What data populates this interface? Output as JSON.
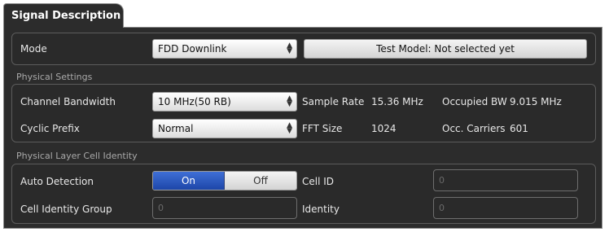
{
  "tab": {
    "label": "Signal Description"
  },
  "mode": {
    "label": "Mode",
    "select_value": "FDD Downlink",
    "test_model_button": "Test Model: Not selected yet"
  },
  "physical_settings": {
    "section_label": "Physical Settings",
    "channel_bandwidth": {
      "label": "Channel Bandwidth",
      "value": "10 MHz(50 RB)"
    },
    "cyclic_prefix": {
      "label": "Cyclic Prefix",
      "value": "Normal"
    },
    "sample_rate": {
      "label": "Sample Rate",
      "value": "15.36 MHz"
    },
    "fft_size": {
      "label": "FFT Size",
      "value": "1024"
    },
    "occupied_bw": {
      "label": "Occupied BW",
      "value": "9.015 MHz"
    },
    "occ_carriers": {
      "label": "Occ. Carriers",
      "value": "601"
    }
  },
  "cell_identity": {
    "section_label": "Physical Layer Cell Identity",
    "auto_detection": {
      "label": "Auto Detection",
      "on": "On",
      "off": "Off"
    },
    "cell_identity_group": {
      "label": "Cell Identity Group",
      "value": "0"
    },
    "cell_id": {
      "label": "Cell ID",
      "value": "0"
    },
    "identity": {
      "label": "Identity",
      "value": "0"
    }
  },
  "colors": {
    "panel_bg": "#2c2c2c",
    "toggle_on": "#2a55c0",
    "label_text": "#e8e8e8",
    "section_text": "#a9a9a9"
  }
}
